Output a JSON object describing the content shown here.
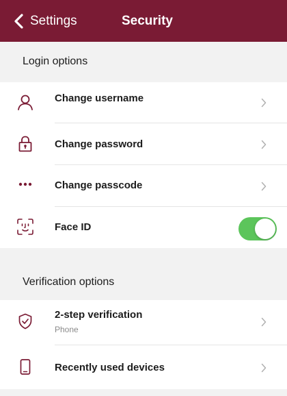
{
  "header": {
    "back_label": "Settings",
    "title": "Security",
    "background": "#7a1b34"
  },
  "sections": {
    "login": {
      "label": "Login options",
      "items": [
        {
          "label": "Change username",
          "icon": "person-icon"
        },
        {
          "label": "Change password",
          "icon": "lock-icon"
        },
        {
          "label": "Change passcode",
          "icon": "dots-icon"
        },
        {
          "label": "Face ID",
          "icon": "face-id-icon",
          "toggle": true
        }
      ]
    },
    "verification": {
      "label": "Verification options",
      "items": [
        {
          "label": "2-step verification",
          "sublabel": "Phone",
          "icon": "shield-check-icon"
        },
        {
          "label": "Recently used devices",
          "icon": "phone-device-icon"
        }
      ]
    }
  },
  "colors": {
    "accent": "#7a1b34",
    "toggle_on": "#5cc55b",
    "chevron": "#b0b0b0"
  }
}
